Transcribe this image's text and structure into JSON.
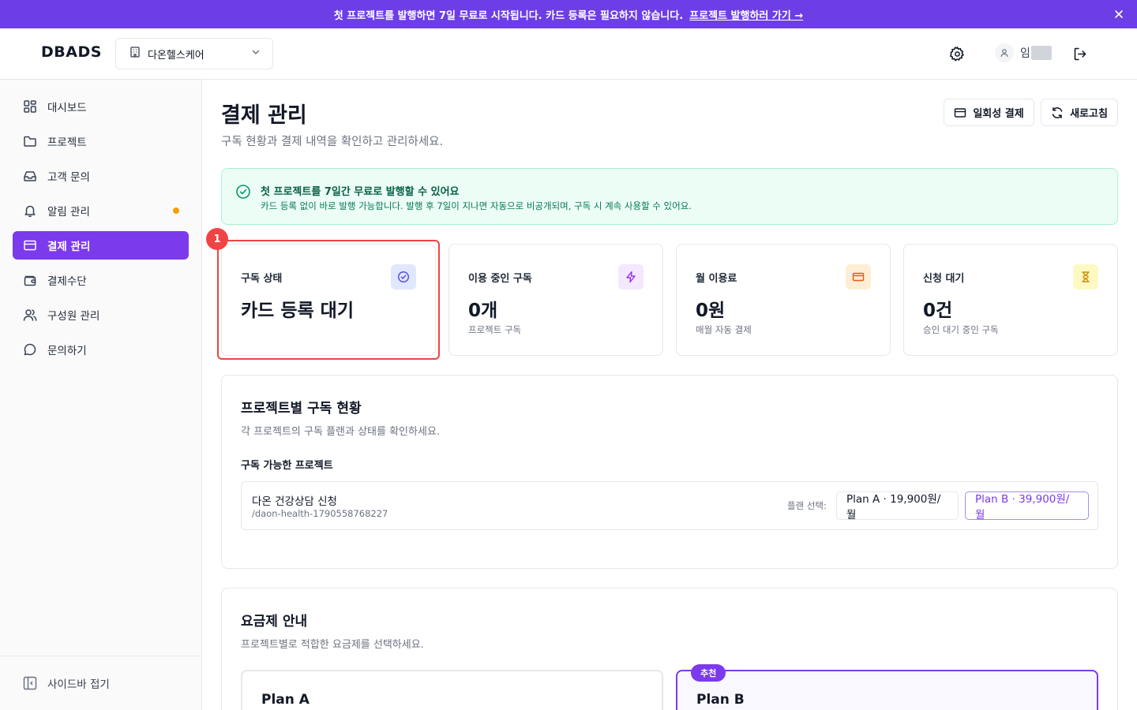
{
  "banner": {
    "text": "첫 프로젝트를 발행하면 7일 무료로 시작됩니다. 카드 등록은 필요하지 않습니다.",
    "link": "프로젝트 발행하러 가기 →"
  },
  "header": {
    "logo": "DBADS",
    "org": "다온헬스케어",
    "user_initial": "임"
  },
  "sidebar": {
    "items": [
      {
        "label": "대시보드",
        "icon": "dashboard-icon"
      },
      {
        "label": "프로젝트",
        "icon": "folder-icon"
      },
      {
        "label": "고객 문의",
        "icon": "inbox-icon"
      },
      {
        "label": "알림 관리",
        "icon": "bell-icon"
      },
      {
        "label": "결제 관리",
        "icon": "credit-card-icon"
      },
      {
        "label": "결제수단",
        "icon": "wallet-icon"
      },
      {
        "label": "구성원 관리",
        "icon": "users-icon"
      },
      {
        "label": "문의하기",
        "icon": "chat-icon"
      }
    ],
    "collapse": "사이드바 접기"
  },
  "page": {
    "title": "결제 관리",
    "subtitle": "구독 현황과 결제 내역을 확인하고 관리하세요.",
    "one_time_btn": "일회성 결제",
    "refresh_btn": "새로고침"
  },
  "notice": {
    "title_pre": "첫 프로젝트를 ",
    "title_bold": "7일간 무료",
    "title_post": "로 발행할 수 있어요",
    "body": "카드 등록 없이 바로 발행 가능합니다. 발행 후 7일이 지나면 자동으로 비공개되며, 구독 시 계속 사용할 수 있어요."
  },
  "stats": [
    {
      "label": "구독 상태",
      "value": "카드 등록 대기",
      "sub": "",
      "color": "#6366f1"
    },
    {
      "label": "이용 중인 구독",
      "value": "0개",
      "sub": "프로젝트 구독",
      "color": "#9333ea"
    },
    {
      "label": "월 이용료",
      "value": "0원",
      "sub": "매월 자동 결제",
      "color": "#ea580c"
    },
    {
      "label": "신청 대기",
      "value": "0건",
      "sub": "승인 대기 중인 구독",
      "color": "#ca8a04"
    }
  ],
  "marker": "1",
  "projects": {
    "title": "프로젝트별 구독 현황",
    "subtitle": "각 프로젝트의 구독 플랜과 상태를 확인하세요.",
    "section_label": "구독 가능한 프로젝트",
    "row": {
      "name": "다온 건강상담 신청",
      "slug": "/daon-health-1790558768227",
      "plan_label": "플랜 선택:",
      "plan_a": "Plan A · 19,900원/월",
      "plan_b": "Plan B · 39,900원/월"
    }
  },
  "pricing": {
    "title": "요금제 안내",
    "subtitle": "프로젝트별로 적합한 요금제를 선택하세요.",
    "plan_a": "Plan A",
    "plan_b": "Plan B",
    "recommended": "추천"
  },
  "colors": {
    "accent": "#7c3aed",
    "banner": "#6d3ee6",
    "highlight": "#ef4444"
  }
}
